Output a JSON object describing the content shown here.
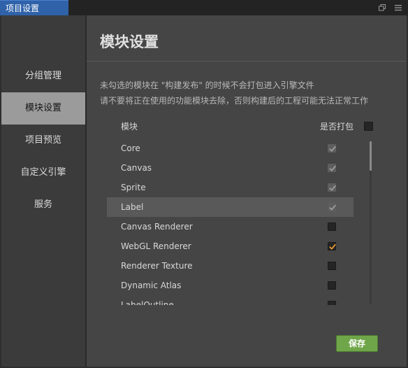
{
  "window": {
    "tab_title": "项目设置",
    "restore_icon": "window-restore-icon",
    "menu_icon": "hamburger-menu-icon"
  },
  "sidebar": {
    "items": [
      {
        "label": "分组管理",
        "active": false
      },
      {
        "label": "模块设置",
        "active": true
      },
      {
        "label": "项目预览",
        "active": false
      },
      {
        "label": "自定义引擎",
        "active": false
      },
      {
        "label": "服务",
        "active": false
      }
    ]
  },
  "main": {
    "title": "模块设置",
    "notice_line1": "未勾选的模块在 \"构建发布\" 的时候不会打包进入引擎文件",
    "notice_line2": "请不要将正在使用的功能模块去除，否则构建后的工程可能无法正常工作",
    "col_module": "模块",
    "col_include": "是否打包",
    "modules": [
      {
        "name": "Core",
        "checked": true,
        "disabled": true,
        "selected": false
      },
      {
        "name": "Canvas",
        "checked": true,
        "disabled": true,
        "selected": false
      },
      {
        "name": "Sprite",
        "checked": true,
        "disabled": true,
        "selected": false
      },
      {
        "name": "Label",
        "checked": true,
        "disabled": true,
        "selected": true
      },
      {
        "name": "Canvas Renderer",
        "checked": false,
        "disabled": false,
        "selected": false
      },
      {
        "name": "WebGL Renderer",
        "checked": true,
        "disabled": false,
        "selected": false
      },
      {
        "name": "Renderer Texture",
        "checked": false,
        "disabled": false,
        "selected": false
      },
      {
        "name": "Dynamic Atlas",
        "checked": false,
        "disabled": false,
        "selected": false
      },
      {
        "name": "LabelOutline",
        "checked": false,
        "disabled": false,
        "selected": false
      }
    ],
    "save_label": "保存"
  },
  "colors": {
    "tab_active": "#2f62a9",
    "sidebar_active": "#9b9b9b",
    "save_button": "#6fa64a",
    "checkmark_enabled": "#f0a030",
    "checkmark_disabled": "#a0a0a0"
  }
}
